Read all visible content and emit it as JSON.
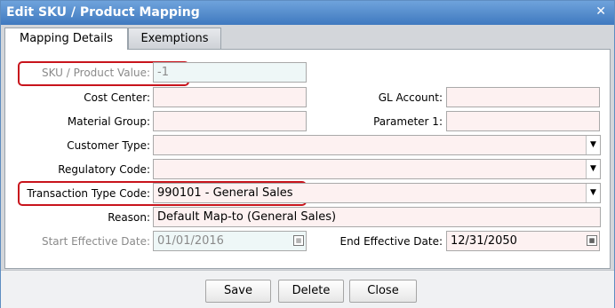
{
  "dialog": {
    "title": "Edit SKU / Product Mapping",
    "close_icon": "close-icon"
  },
  "tabs": [
    {
      "label": "Mapping Details",
      "active": true
    },
    {
      "label": "Exemptions",
      "active": false
    }
  ],
  "form": {
    "sku": {
      "label": "SKU / Product Value:",
      "value": "-1",
      "disabled": true
    },
    "cost_center": {
      "label": "Cost Center:",
      "value": ""
    },
    "gl_account": {
      "label": "GL Account:",
      "value": ""
    },
    "material_group": {
      "label": "Material Group:",
      "value": ""
    },
    "parameter1": {
      "label": "Parameter 1:",
      "value": ""
    },
    "customer_type": {
      "label": "Customer Type:",
      "value": ""
    },
    "regulatory_code": {
      "label": "Regulatory Code:",
      "value": ""
    },
    "transaction_type": {
      "label": "Transaction Type Code:",
      "value": "990101 - General Sales"
    },
    "reason": {
      "label": "Reason:",
      "value": "Default Map-to (General Sales)"
    },
    "start_date": {
      "label": "Start Effective Date:",
      "value": "01/01/2016",
      "disabled": true
    },
    "end_date": {
      "label": "End Effective Date:",
      "value": "12/31/2050"
    }
  },
  "buttons": {
    "save": "Save",
    "delete": "Delete",
    "close": "Close"
  },
  "colors": {
    "highlight": "#c8141c",
    "titlebar": "#3f79bf",
    "required_field": "#fdf1f1"
  }
}
